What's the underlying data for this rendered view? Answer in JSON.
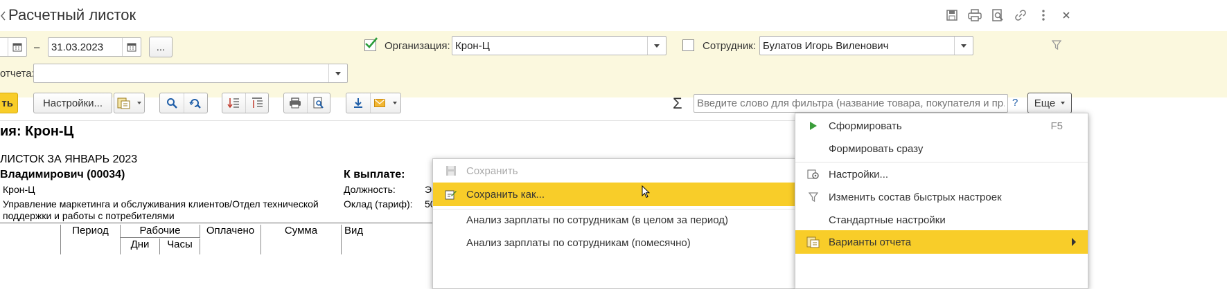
{
  "window": {
    "title": "Расчетный листок"
  },
  "filters": {
    "date_to": "31.03.2023",
    "dash": "–",
    "more_dates_label": "...",
    "organization_label": "Организация:",
    "organization_value": "Крон-Ц",
    "employee_label": "Сотрудник:",
    "employee_value": "Булатов Игорь Виленович",
    "report_variant_label": "отчета:",
    "report_variant_value": ""
  },
  "toolbar": {
    "generate_label": "ть",
    "settings_label": "Настройки...",
    "search_placeholder": "Введите слово для фильтра (название товара, покупателя и пр.)",
    "help_label": "?",
    "more_label": "Еще",
    "sigma": "Σ"
  },
  "report": {
    "org_header": "ия: Крон-Ц",
    "title": "ЛИСТОК ЗА ЯНВАРЬ 2023",
    "employee_line": "Владимирович (00034)",
    "to_pay_label": "К выплате:",
    "org_name": "Крон-Ц",
    "department_line1": "Управление маркетинга и обслуживания клиентов/Отдел технической",
    "department_line2": "поддержки и работы с потребителями",
    "position_label": "Должность:",
    "position_value": "Э",
    "salary_label": "Оклад (тариф):",
    "salary_value": "50",
    "col_period": "Период",
    "col_working": "Рабочие",
    "col_days": "Дни",
    "col_hours": "Часы",
    "col_paid": "Оплачено",
    "col_sum": "Сумма",
    "col_type": "Вид"
  },
  "save_menu": {
    "items": [
      {
        "label": "Сохранить",
        "disabled": true
      },
      {
        "label": "Сохранить как...",
        "highlighted": true
      },
      {
        "label": "Анализ зарплаты по сотрудникам (в целом за период)"
      },
      {
        "label": "Анализ зарплаты по сотрудникам (помесячно)"
      }
    ]
  },
  "more_menu": {
    "items": [
      {
        "label": "Сформировать",
        "shortcut": "F5"
      },
      {
        "label": "Формировать сразу"
      },
      {
        "label": "Настройки..."
      },
      {
        "label": "Изменить состав быстрых настроек"
      },
      {
        "label": "Стандартные настройки"
      },
      {
        "label": "Варианты отчета",
        "highlighted": true
      }
    ]
  },
  "colors": {
    "filter_bg": "#fbf8de",
    "accent": "#f8cd29",
    "check_green": "#2a9d3a",
    "link_blue": "#1f5ea8"
  }
}
